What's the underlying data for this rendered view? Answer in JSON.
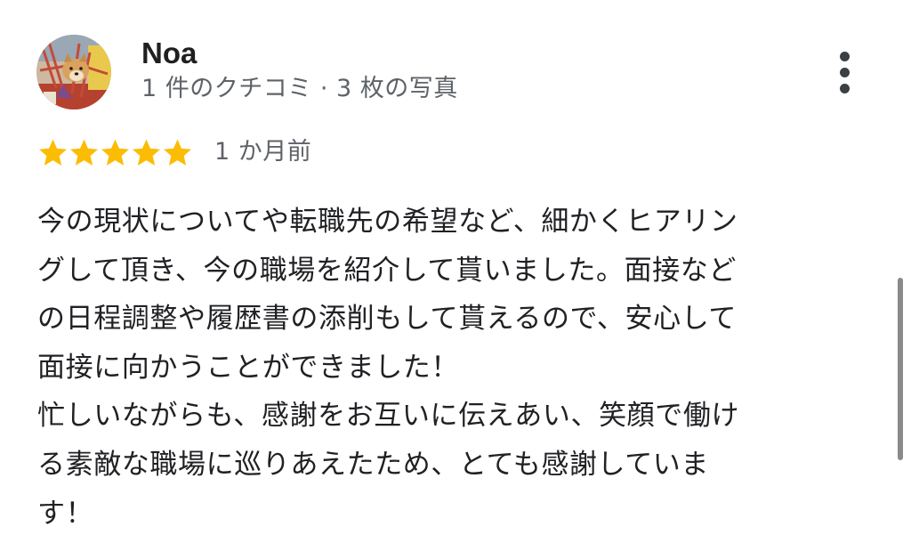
{
  "reviewer": {
    "name": "Noa",
    "meta": "1 件のクチコミ · 3 枚の写真"
  },
  "rating": {
    "stars": 5,
    "max": 5,
    "star_color": "#fbbc04",
    "date": "1 か月前"
  },
  "review": {
    "lines": [
      "今の現状についてや転職先の希望など、細かくヒアリン",
      "グして頂き、今の職場を紹介して貰いました。面接など",
      "の日程調整や履歴書の添削もして貰えるので、安心して",
      "面接に向かうことができました！",
      "忙しいながらも、感謝をお互いに伝えあい、笑顔で働け",
      "る素敵な職場に巡りあえたため、とても感謝していま",
      "す！"
    ]
  },
  "icons": {
    "avatar": "profile-photo",
    "more": "more-vert-icon",
    "star": "star-icon"
  }
}
